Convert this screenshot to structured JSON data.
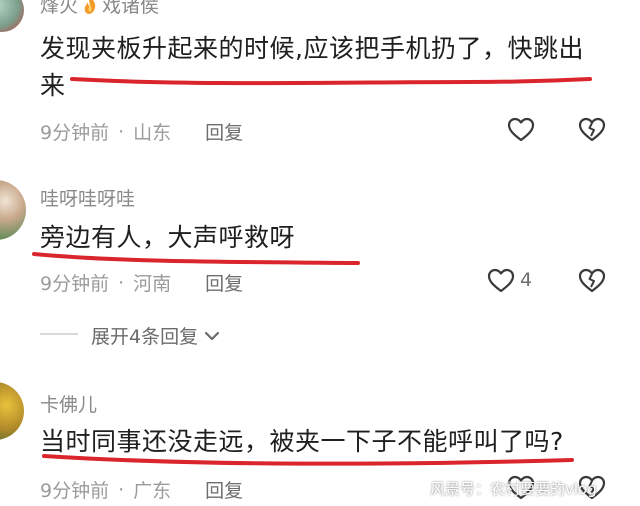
{
  "colors": {
    "underline_red": "#d9252b",
    "text": "#1f1f1f",
    "meta": "#9b9b9b"
  },
  "comments": [
    {
      "username": "烽火",
      "badge_icon": "fire-icon",
      "suffix": "戏诸侯",
      "content_line1": "发现夹板升起来的时候,应该把手机扔了，快跳出",
      "content_line2": "来",
      "time": "9分钟前",
      "separator": "·",
      "location": "山东",
      "reply_label": "回复"
    },
    {
      "username": "哇呀哇呀哇",
      "content_line1": "旁边有人，大声呼救呀",
      "time": "9分钟前",
      "separator": "·",
      "location": "河南",
      "reply_label": "回复",
      "like_count": "4"
    },
    {
      "username": "卡佛儿",
      "content_line1": "当时同事还没走远，被夹一下子不能呼叫了吗?",
      "time": "9分钟前",
      "separator": "·",
      "location": "广东",
      "reply_label": "回复"
    }
  ],
  "expand_replies": {
    "label": "展开4条回复",
    "icon": "chevron-down-icon"
  },
  "watermark": "风景号：农村要要的vlog"
}
